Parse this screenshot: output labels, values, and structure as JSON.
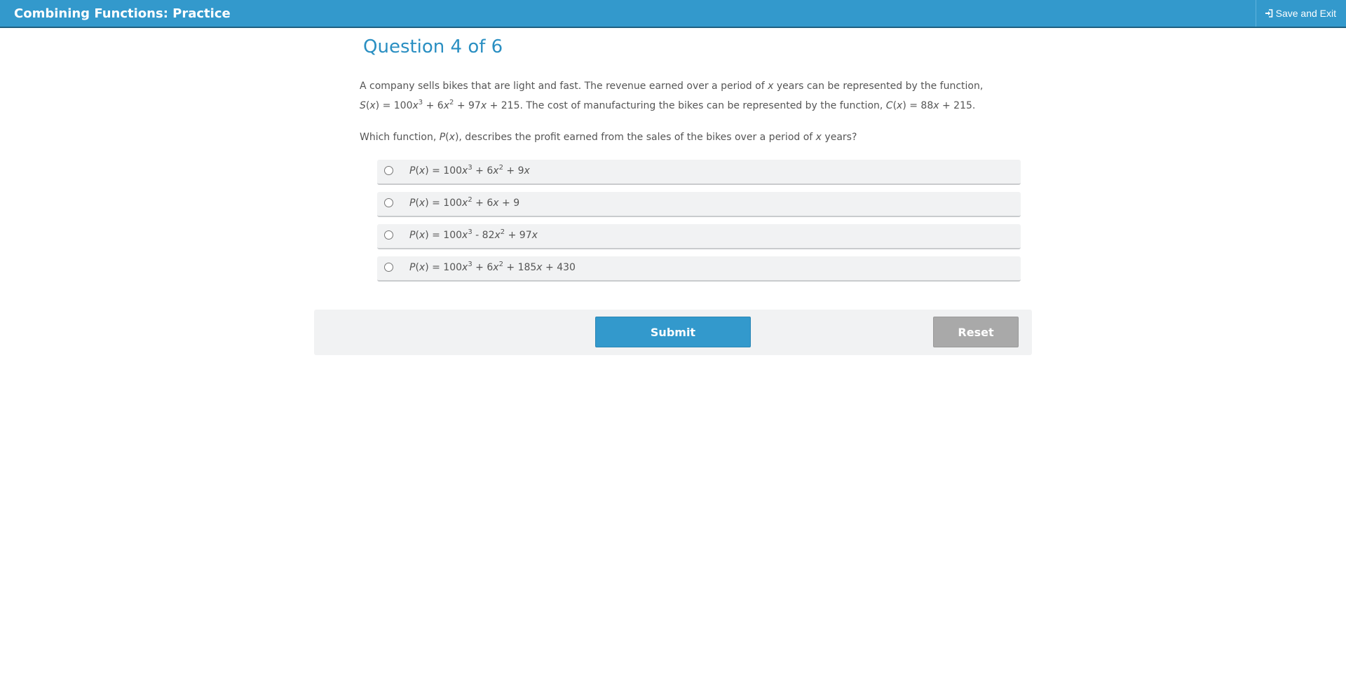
{
  "header": {
    "title": "Combining Functions: Practice",
    "save_exit_label": "Save and Exit",
    "save_exit_icon": "sign-in-icon",
    "bar_color": "#3399cc"
  },
  "question": {
    "heading": "Question 4 of 6",
    "prompt_line1": {
      "t1": "A company sells bikes that are light and fast. The revenue earned over a period of ",
      "x1": "x",
      "t2": " years can be represented by the function,"
    },
    "prompt_line2": {
      "s": "S",
      "p1": "(",
      "x1": "x",
      "p2": ") = 100",
      "x2": "x",
      "e1": "3",
      "p3": " + 6",
      "x3": "x",
      "e2": "2",
      "p4": " + 97",
      "x4": "x",
      "p5": " + 215. The cost of manufacturing the bikes can be represented by the function, ",
      "c": "C",
      "p6": "(",
      "x5": "x",
      "p7": ") = 88",
      "x6": "x",
      "p8": " + 215."
    },
    "ask": {
      "t1": "Which function, ",
      "p": "P",
      "t2": "(",
      "x1": "x",
      "t3": "), describes the profit earned from the sales of the bikes over a period of ",
      "x2": "x",
      "t4": " years?"
    }
  },
  "choices": [
    {
      "p": "P",
      "a": "(",
      "x1": "x",
      "b": ") = 100",
      "x2": "x",
      "e1": "3",
      "c": " + 6",
      "x3": "x",
      "e2": "2",
      "d": " + 9",
      "x4": "x"
    },
    {
      "p": "P",
      "a": "(",
      "x1": "x",
      "b": ") = 100",
      "x2": "x",
      "e1": "2",
      "c": " + 6",
      "x3": "x",
      "d": " + 9"
    },
    {
      "p": "P",
      "a": "(",
      "x1": "x",
      "b": ") = 100",
      "x2": "x",
      "e1": "3",
      "c": " - 82",
      "x3": "x",
      "e2": "2",
      "d": " + 97",
      "x4": "x"
    },
    {
      "p": "P",
      "a": "(",
      "x1": "x",
      "b": ") = 100",
      "x2": "x",
      "e1": "3",
      "c": " + 6",
      "x3": "x",
      "e2": "2",
      "d": " + 185",
      "x4": "x",
      "f": " + 430"
    }
  ],
  "actions": {
    "submit_label": "Submit",
    "reset_label": "Reset",
    "submit_color": "#3399cc",
    "reset_color": "#a9a9a9"
  }
}
